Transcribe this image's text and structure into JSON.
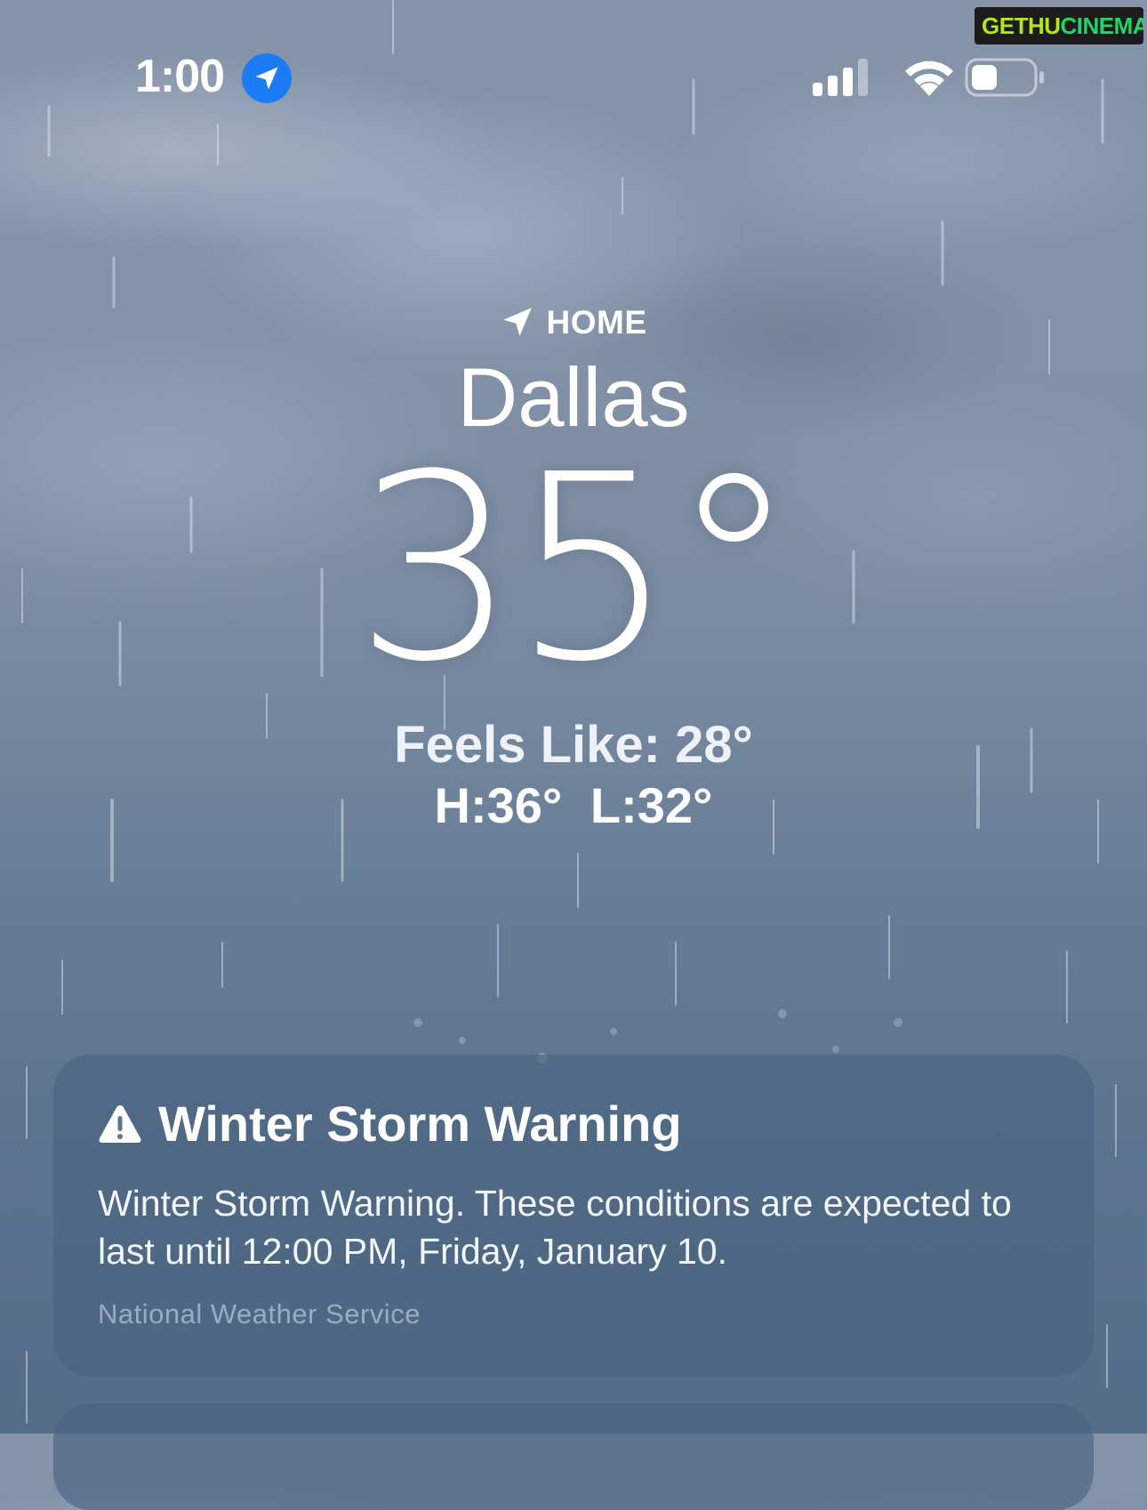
{
  "status_bar": {
    "time": "1:00",
    "icons": [
      "location-arrow-icon",
      "cellular-signal-icon",
      "wifi-icon",
      "battery-icon"
    ]
  },
  "watermark": {
    "part1": "GETHU",
    "part2": "CINEMA"
  },
  "location": {
    "label": "HOME",
    "icon": "location-arrow-icon",
    "city": "Dallas"
  },
  "weather": {
    "temperature": "35°",
    "feels_like": "Feels Like: 28°",
    "high": "H:36°",
    "low": "L:32°"
  },
  "alert": {
    "icon": "warning-triangle-icon",
    "title": "Winter Storm Warning",
    "body": "Winter Storm Warning. These conditions are expected to last until 12:00 PM, Friday, January 10.",
    "source": "National Weather Service"
  },
  "colors": {
    "sky_top": "#8593a8",
    "sky_bottom": "#546d88",
    "location_badge": "#1b7cf5",
    "card_background": "#48637f"
  }
}
